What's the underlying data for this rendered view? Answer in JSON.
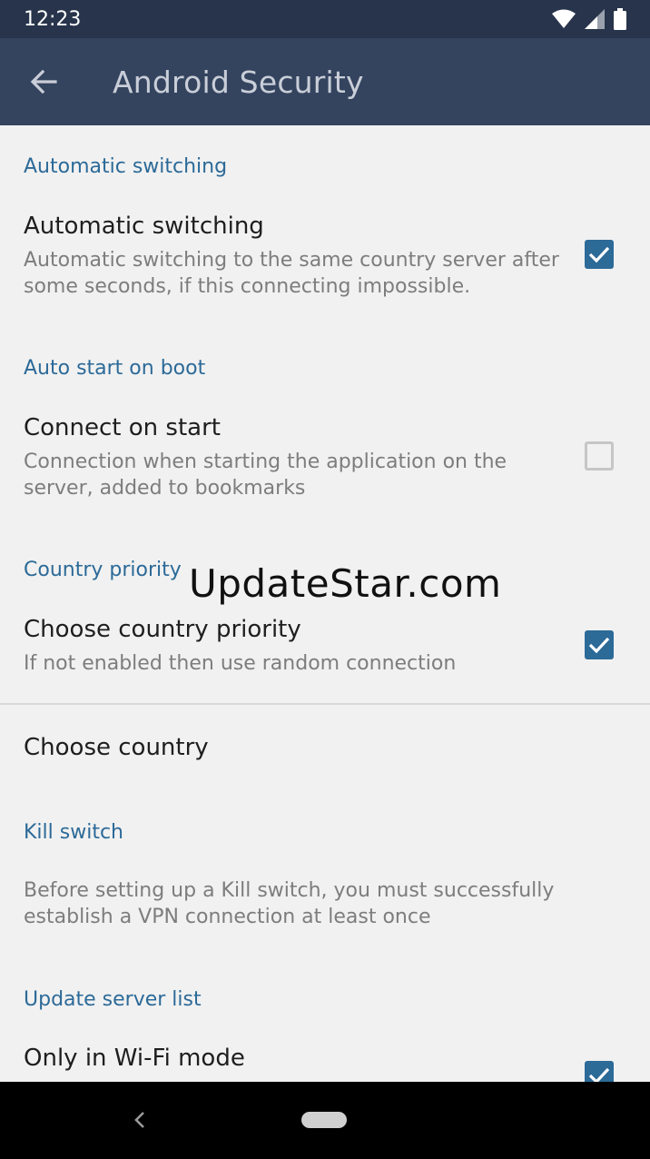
{
  "status_bar": {
    "time": "12:23",
    "icons": [
      "wifi-icon",
      "signal-icon",
      "battery-icon"
    ]
  },
  "app_bar": {
    "title": "Android Security",
    "back_icon": "arrow-back-icon"
  },
  "sections": {
    "automatic_switching": {
      "header": "Automatic switching",
      "pref_title": "Automatic switching",
      "pref_summary": "Automatic switching to the same country server after some seconds, if this connecting impossible.",
      "checked": true
    },
    "auto_start": {
      "header": "Auto start on boot",
      "pref_title": "Connect on start",
      "pref_summary": "Connection when starting the application on the server, added to bookmarks",
      "checked": false
    },
    "country_priority": {
      "header": "Country priority",
      "pref_title": "Choose country priority",
      "pref_summary": "If not enabled then use random connection",
      "checked": true
    },
    "choose_country": {
      "pref_title": "Choose country"
    },
    "kill_switch": {
      "header": "Kill switch",
      "pref_summary": "Before setting up a Kill switch, you must successfully establish a VPN connection at least once"
    },
    "update_server_list": {
      "header": "Update server list",
      "pref_title": "Only in Wi-Fi mode",
      "checked": true
    }
  },
  "watermark": "UpdateStar.com",
  "colors": {
    "status_bar": "#27344b",
    "app_bar": "#34445f",
    "accent": "#2c6a98",
    "background": "#f1f1f1"
  }
}
